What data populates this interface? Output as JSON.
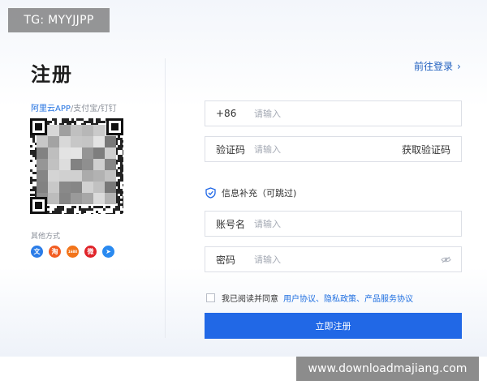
{
  "watermarks": {
    "top": "TG: MYYJJPP",
    "bottom": "www.downloadmajiang.com"
  },
  "header": {
    "title": "注册",
    "login_link": "前往登录"
  },
  "left_panel": {
    "app_links": {
      "primary": "阿里云APP",
      "rest": "/支付宝/钉钉"
    },
    "other_methods_label": "其他方式",
    "social": [
      {
        "icon": "wenwen-icon",
        "glyph": "文",
        "color": "#2a7ce8"
      },
      {
        "icon": "taobao-icon",
        "glyph": "淘",
        "color": "#f25d22"
      },
      {
        "icon": "1688-icon",
        "glyph": "1688",
        "color": "#f2741a"
      },
      {
        "icon": "weibo-icon",
        "glyph": "微",
        "color": "#e0242a"
      },
      {
        "icon": "dingtalk-icon",
        "glyph": "➤",
        "color": "#2a8af0"
      }
    ]
  },
  "form": {
    "phone": {
      "prefix": "+86",
      "placeholder": "请输入"
    },
    "code": {
      "label": "验证码",
      "placeholder": "请输入",
      "action": "获取验证码"
    },
    "section_title": "信息补充（可跳过)",
    "account": {
      "label": "账号名",
      "placeholder": "请输入"
    },
    "password": {
      "label": "密码",
      "placeholder": "请输入"
    },
    "agreement": {
      "prefix": "我已阅读并同意",
      "links": "用户协议、隐私政策、产品服务协议"
    },
    "submit": "立即注册"
  },
  "colors": {
    "brand_blue": "#2168e6",
    "link_blue": "#1f6fe0"
  }
}
